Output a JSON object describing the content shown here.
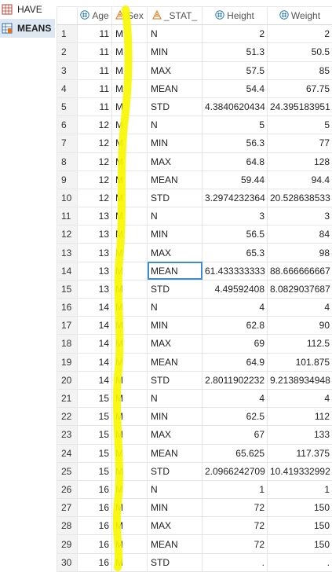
{
  "datasets": [
    {
      "label": "HAVE",
      "icon": "table-icon",
      "selected": false
    },
    {
      "label": "MEANS",
      "icon": "table-stats-icon",
      "selected": true
    }
  ],
  "columns": [
    {
      "label": "",
      "icon": ""
    },
    {
      "label": "Age",
      "icon": "numeric-column-icon"
    },
    {
      "label": "Sex",
      "icon": "character-column-icon"
    },
    {
      "label": "_STAT_",
      "icon": "character-column-icon"
    },
    {
      "label": "Height",
      "icon": "numeric-column-icon"
    },
    {
      "label": "Weight",
      "icon": "numeric-column-icon"
    }
  ],
  "rows": [
    [
      "1",
      "11",
      "M",
      "N",
      "2",
      "2"
    ],
    [
      "2",
      "11",
      "M",
      "MIN",
      "51.3",
      "50.5"
    ],
    [
      "3",
      "11",
      "M",
      "MAX",
      "57.5",
      "85"
    ],
    [
      "4",
      "11",
      "M",
      "MEAN",
      "54.4",
      "67.75"
    ],
    [
      "5",
      "11",
      "M",
      "STD",
      "4.3840620434",
      "24.395183951"
    ],
    [
      "6",
      "12",
      "M",
      "N",
      "5",
      "5"
    ],
    [
      "7",
      "12",
      "M",
      "MIN",
      "56.3",
      "77"
    ],
    [
      "8",
      "12",
      "M",
      "MAX",
      "64.8",
      "128"
    ],
    [
      "9",
      "12",
      "M",
      "MEAN",
      "59.44",
      "94.4"
    ],
    [
      "10",
      "12",
      "M",
      "STD",
      "3.2974232364",
      "20.528638533"
    ],
    [
      "11",
      "13",
      "M",
      "N",
      "3",
      "3"
    ],
    [
      "12",
      "13",
      "M",
      "MIN",
      "56.5",
      "84"
    ],
    [
      "13",
      "13",
      "M",
      "MAX",
      "65.3",
      "98"
    ],
    [
      "14",
      "13",
      "M",
      "MEAN",
      "61.433333333",
      "88.666666667"
    ],
    [
      "15",
      "13",
      "M",
      "STD",
      "4.49592408",
      "8.0829037687"
    ],
    [
      "16",
      "14",
      "M",
      "N",
      "4",
      "4"
    ],
    [
      "17",
      "14",
      "M",
      "MIN",
      "62.8",
      "90"
    ],
    [
      "18",
      "14",
      "M",
      "MAX",
      "69",
      "112.5"
    ],
    [
      "19",
      "14",
      "M",
      "MEAN",
      "64.9",
      "101.875"
    ],
    [
      "20",
      "14",
      "M",
      "STD",
      "2.8011902232",
      "9.2138934948"
    ],
    [
      "21",
      "15",
      "M",
      "N",
      "4",
      "4"
    ],
    [
      "22",
      "15",
      "M",
      "MIN",
      "62.5",
      "112"
    ],
    [
      "23",
      "15",
      "M",
      "MAX",
      "67",
      "133"
    ],
    [
      "24",
      "15",
      "M",
      "MEAN",
      "65.625",
      "117.375"
    ],
    [
      "25",
      "15",
      "M",
      "STD",
      "2.0966242709",
      "10.419332992"
    ],
    [
      "26",
      "16",
      "M",
      "N",
      "1",
      "1"
    ],
    [
      "27",
      "16",
      "M",
      "MIN",
      "72",
      "150"
    ],
    [
      "28",
      "16",
      "M",
      "MAX",
      "72",
      "150"
    ],
    [
      "29",
      "16",
      "M",
      "MEAN",
      "72",
      "150"
    ],
    [
      "30",
      "16",
      "M",
      "STD",
      ".",
      "."
    ]
  ],
  "selected_cell": {
    "row": 14,
    "column": "_STAT_"
  },
  "colors": {
    "highlighter": "#f7f700",
    "numeric_icon": "#2a7ab8",
    "character_icon": "#e07a1f",
    "selection": "#3c8bd9"
  }
}
